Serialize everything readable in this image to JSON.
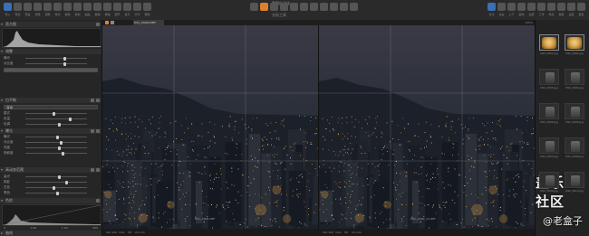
{
  "toolbar": {
    "title": "截图自动化",
    "subtitle": "光标工具",
    "left_labels": [
      "导入",
      "导出",
      "预设",
      "智能",
      "调整",
      "样式",
      "编辑",
      "复制",
      "粘贴",
      "撤销",
      "重做",
      "细节",
      "显示",
      "打印",
      "帮助"
    ],
    "right_labels": [
      "对比",
      "左右",
      "上下",
      "画布",
      "全屏",
      "工作",
      "导出",
      "提取",
      "设置",
      "更多"
    ]
  },
  "left_panel": {
    "histogram_title": "直方图",
    "sections": [
      {
        "title": "调整",
        "rows": [
          {
            "label": "曝光"
          },
          {
            "label": "对比度"
          }
        ]
      },
      {
        "title": "白平衡",
        "select": "自动",
        "rows": [
          {
            "label": "模式"
          },
          {
            "label": "色温"
          },
          {
            "label": "色调"
          }
        ]
      },
      {
        "title": "曝光",
        "rows": [
          {
            "label": "曝光"
          },
          {
            "label": "对比度"
          },
          {
            "label": "亮度"
          },
          {
            "label": "饱和度"
          }
        ]
      },
      {
        "title": "高动态范围",
        "rows": [
          {
            "label": "高光"
          },
          {
            "label": "阴影"
          },
          {
            "label": "白色"
          },
          {
            "label": "黑色"
          }
        ]
      },
      {
        "title": "色阶"
      },
      {
        "title": "曲线"
      }
    ],
    "levels_values": [
      "0",
      "0.00",
      "1.00",
      "255"
    ]
  },
  "viewer": {
    "file_name": "DSC_00000.NEF",
    "header_right": "100%",
    "left_caption": "DSC_0000.NEF",
    "right_caption": "DSC_0000_(2).NEF",
    "footer_left": [
      "ISO 100",
      "1/2s",
      "f/8",
      "24 mm"
    ],
    "footer_right": [
      "ISO 100",
      "1/2s",
      "f/8",
      "24 mm"
    ]
  },
  "right_panel": {
    "thumbs": [
      {
        "label": "DSC_0001.jpg",
        "kind": "dog"
      },
      {
        "label": "DSC_0002.jpg",
        "kind": "dog"
      },
      {
        "label": "DSC_0003.jpg",
        "kind": "cam"
      },
      {
        "label": "DSC_0004.jpg",
        "kind": "cam"
      },
      {
        "label": "DSC_0005.jpg",
        "kind": "cam"
      },
      {
        "label": "DSC_0006.jpg",
        "kind": "cam"
      },
      {
        "label": "DSC_0007.jpg",
        "kind": "cam"
      },
      {
        "label": "DSC_0008.jpg",
        "kind": "cam"
      },
      {
        "label": "DSC_0009.jpg",
        "kind": "cam"
      },
      {
        "label": "DSC_0010.jpg",
        "kind": "cam"
      }
    ]
  },
  "watermark": {
    "line1": "盖乐世社区",
    "line2": "@老盒子"
  }
}
